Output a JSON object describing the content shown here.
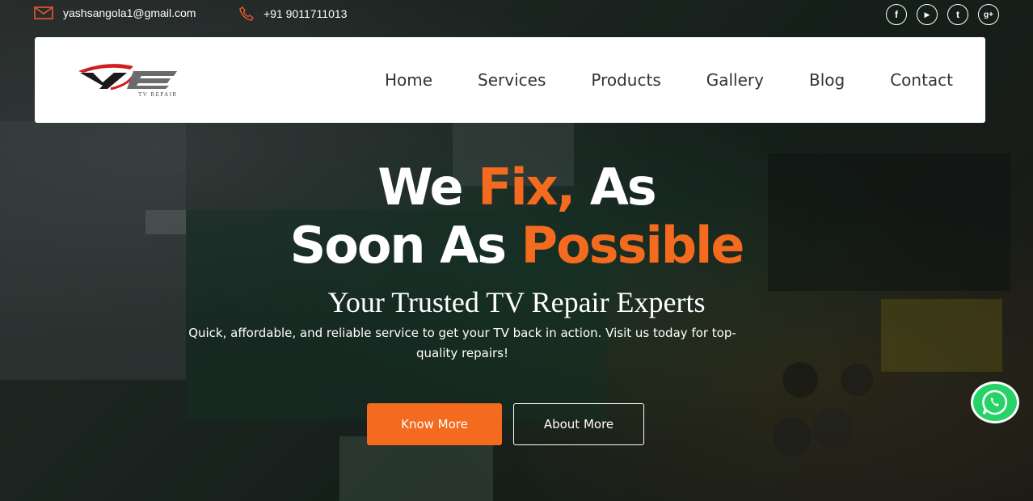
{
  "topbar": {
    "email": "yashsangola1@gmail.com",
    "phone": "+91 9011711013",
    "social": [
      {
        "icon": "facebook-icon",
        "glyph": "f"
      },
      {
        "icon": "youtube-icon",
        "glyph": "▶"
      },
      {
        "icon": "twitter-icon",
        "glyph": "t"
      },
      {
        "icon": "google-plus-icon",
        "glyph": "g+"
      }
    ]
  },
  "logo": {
    "mark": "YE",
    "tagline": "TV REPAIR"
  },
  "nav": {
    "items": [
      "Home",
      "Services",
      "Products",
      "Gallery",
      "Blog",
      "Contact"
    ]
  },
  "hero": {
    "line1_a": "We ",
    "line1_b": "Fix,",
    "line1_c": " As",
    "line2_a": "Soon As ",
    "line2_b": "Possible",
    "subtitle": "Your Trusted TV Repair Experts",
    "description": "Quick, affordable, and reliable service to get your TV back in action. Visit us today for top-quality repairs!",
    "primary_button": "Know More",
    "secondary_button": "About More"
  },
  "colors": {
    "accent": "#f46a1e",
    "whatsapp": "#25d366"
  }
}
